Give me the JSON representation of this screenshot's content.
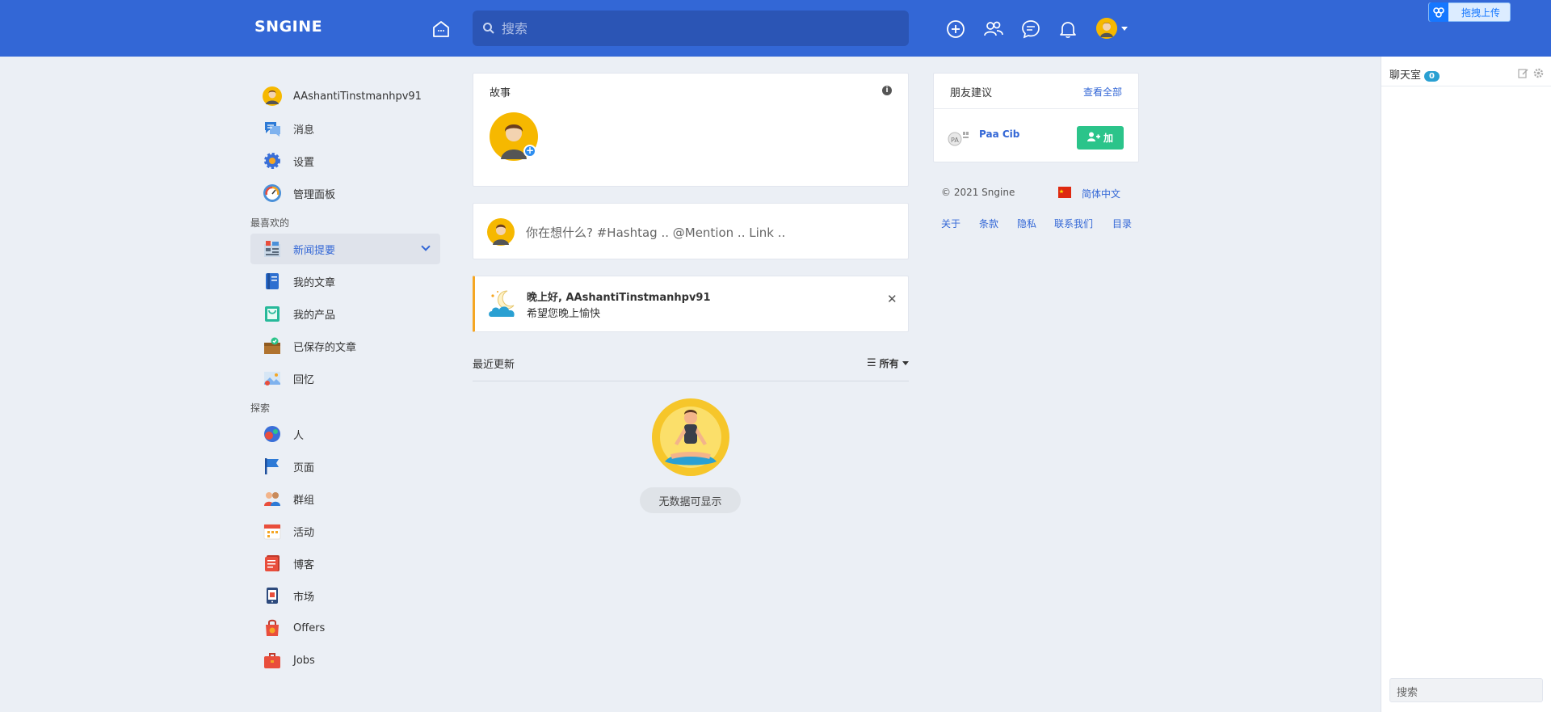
{
  "header": {
    "logo": "SNGINE",
    "search_placeholder": "搜索"
  },
  "upload": {
    "label": "拖拽上传"
  },
  "sidebar": {
    "user": "AAshantiTinstmanhpv91",
    "main_items": [
      {
        "label": "消息",
        "icon": "messages-icon"
      },
      {
        "label": "设置",
        "icon": "settings-icon"
      },
      {
        "label": "管理面板",
        "icon": "admin-dashboard-icon"
      }
    ],
    "favorites_title": "最喜欢的",
    "favorites": [
      {
        "label": "新闻提要",
        "icon": "newsfeed-icon",
        "active": true
      },
      {
        "label": "我的文章",
        "icon": "articles-icon"
      },
      {
        "label": "我的产品",
        "icon": "products-icon"
      },
      {
        "label": "已保存的文章",
        "icon": "saved-icon"
      },
      {
        "label": "回忆",
        "icon": "memories-icon"
      }
    ],
    "explore_title": "探索",
    "explore": [
      {
        "label": "人",
        "icon": "people-icon"
      },
      {
        "label": "页面",
        "icon": "pages-icon"
      },
      {
        "label": "群组",
        "icon": "groups-icon"
      },
      {
        "label": "活动",
        "icon": "events-icon"
      },
      {
        "label": "博客",
        "icon": "blogs-icon"
      },
      {
        "label": "市场",
        "icon": "market-icon"
      },
      {
        "label": "Offers",
        "icon": "offers-icon"
      },
      {
        "label": "Jobs",
        "icon": "jobs-icon"
      }
    ]
  },
  "stories": {
    "title": "故事"
  },
  "composer": {
    "placeholder": "你在想什么? #Hashtag .. @Mention .. Link .."
  },
  "greeting": {
    "title": "晚上好, AAshantiTinstmanhpv91",
    "subtitle": "希望您晚上愉快"
  },
  "feed": {
    "title": "最近更新",
    "filter": "所有",
    "empty_text": "无数据可显示"
  },
  "suggestions": {
    "title": "朋友建议",
    "see_all": "查看全部",
    "people": [
      {
        "name": "Paa Cib",
        "button": "加"
      }
    ]
  },
  "footer": {
    "copyright": "© 2021 Sngine",
    "language": "简体中文",
    "links": [
      "关于",
      "条款",
      "隐私",
      "联系我们",
      "目录"
    ]
  },
  "chat": {
    "title": "聊天室",
    "count": "0",
    "search_placeholder": "搜索"
  },
  "colors": {
    "brand": "#3367d6",
    "background": "#ebeff5",
    "success": "#2bc48a"
  }
}
